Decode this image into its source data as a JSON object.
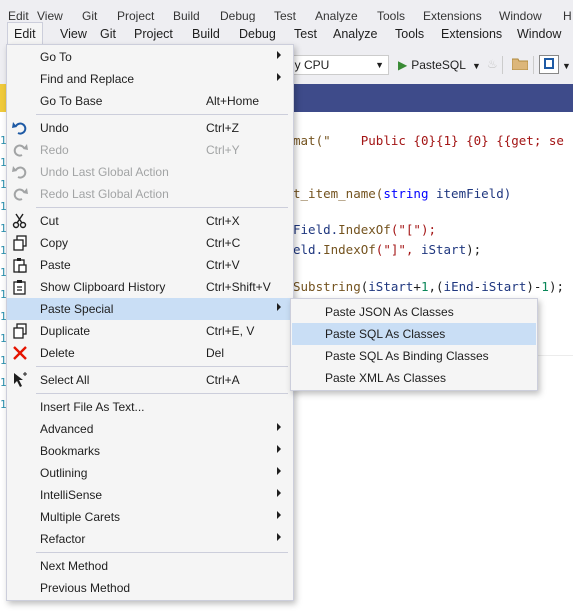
{
  "menubar": {
    "items": [
      "Edit",
      "View",
      "Git",
      "Project",
      "Build",
      "Debug",
      "Test",
      "Analyze",
      "Tools",
      "Extensions",
      "Window"
    ],
    "ghost_items": [
      "Edit",
      "View",
      "Git",
      "Project",
      "Build",
      "Debug",
      "Test",
      "Analyze",
      "Tools",
      "Extensions",
      "Window",
      "H"
    ]
  },
  "toolbar": {
    "platform": "ny CPU",
    "run_label": "PasteSQL",
    "colors": {
      "run": "#388a34",
      "accent": "#1e5aa5"
    }
  },
  "edit_menu": {
    "items": [
      {
        "label": "Go To",
        "submenu": true
      },
      {
        "label": "Find and Replace",
        "submenu": true
      },
      {
        "label": "Go To Base",
        "shortcut": "Alt+Home"
      },
      {
        "label": "Undo",
        "shortcut": "Ctrl+Z",
        "icon": "undo-icon"
      },
      {
        "label": "Redo",
        "shortcut": "Ctrl+Y",
        "icon": "redo-icon",
        "disabled": true
      },
      {
        "label": "Undo Last Global Action",
        "icon": "undo-global-icon",
        "disabled": true
      },
      {
        "label": "Redo Last Global Action",
        "icon": "redo-global-icon",
        "disabled": true
      },
      {
        "label": "Cut",
        "shortcut": "Ctrl+X",
        "icon": "scissors-icon"
      },
      {
        "label": "Copy",
        "shortcut": "Ctrl+C",
        "icon": "copy-icon"
      },
      {
        "label": "Paste",
        "shortcut": "Ctrl+V",
        "icon": "paste-icon"
      },
      {
        "label": "Show Clipboard History",
        "shortcut": "Ctrl+Shift+V",
        "icon": "clipboard-icon"
      },
      {
        "label": "Paste Special",
        "submenu": true,
        "highlighted": true
      },
      {
        "label": "Duplicate",
        "shortcut": "Ctrl+E, V",
        "icon": "duplicate-icon"
      },
      {
        "label": "Delete",
        "shortcut": "Del",
        "icon": "delete-icon"
      },
      {
        "label": "Select All",
        "shortcut": "Ctrl+A",
        "icon": "select-all-icon"
      },
      {
        "label": "Insert File As Text..."
      },
      {
        "label": "Advanced",
        "submenu": true
      },
      {
        "label": "Bookmarks",
        "submenu": true
      },
      {
        "label": "Outlining",
        "submenu": true
      },
      {
        "label": "IntelliSense",
        "submenu": true
      },
      {
        "label": "Multiple Carets",
        "submenu": true
      },
      {
        "label": "Refactor",
        "submenu": true
      },
      {
        "label": "Next Method"
      },
      {
        "label": "Previous Method"
      }
    ],
    "colors": {
      "highlight": "#c9def5",
      "undo": "#1e5aa5",
      "delete": "#e51400",
      "disabled": "#a2a4a5"
    }
  },
  "paste_special_menu": {
    "items": [
      {
        "label": "Paste JSON As Classes"
      },
      {
        "label": "Paste SQL As Classes",
        "highlighted": true
      },
      {
        "label": "Paste SQL As Binding Classes"
      },
      {
        "label": "Paste XML As Classes"
      }
    ]
  },
  "code": {
    "gutter_marks": [
      "1",
      "1",
      "1",
      "1",
      "1",
      "1",
      "1",
      "1",
      "1",
      "1",
      "1",
      "1",
      "1"
    ],
    "line1": [
      "mat(\"",
      "    Public {0}{1} {0} {{get; se"
    ],
    "line2": [
      "t_item_name(",
      "string",
      " itemField)"
    ],
    "line3": [
      "Field.",
      "IndexOf",
      "(\"[\");"
    ],
    "line4": [
      "eld.",
      "IndexOf",
      "(\"]\", ",
      "iStart",
      ");"
    ],
    "line5": [
      "Substring",
      "(",
      "iStart",
      "+",
      "1",
      ",(",
      "iEnd",
      "-",
      "iStart",
      ")-",
      "1",
      ");"
    ]
  }
}
